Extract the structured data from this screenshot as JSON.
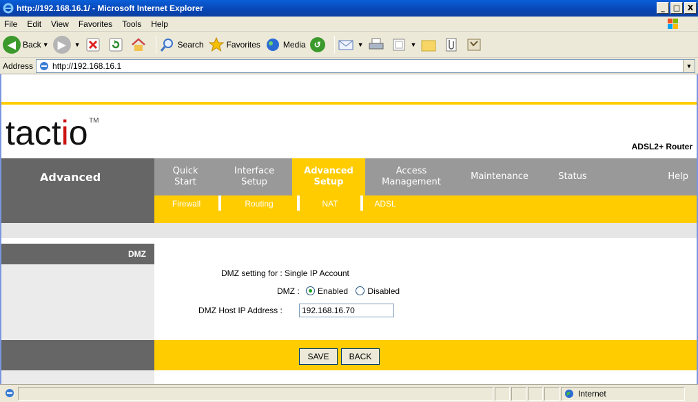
{
  "window": {
    "title": "http://192.168.16.1/ - Microsoft Internet Explorer",
    "controls": {
      "minimize": "_",
      "maximize": "□",
      "close": "X"
    }
  },
  "menubar": {
    "items": [
      "File",
      "Edit",
      "View",
      "Favorites",
      "Tools",
      "Help"
    ]
  },
  "toolbar": {
    "back_label": "Back",
    "search_label": "Search",
    "favorites_label": "Favorites",
    "media_label": "Media"
  },
  "address": {
    "label": "Address",
    "url": "http://192.168.16.1"
  },
  "page": {
    "logo": {
      "main_dark": "tact",
      "accent": "i",
      "end_dark": "o",
      "tm": "TM"
    },
    "product": "ADSL2+ Router",
    "section": "Advanced",
    "nav": [
      {
        "l1": "Quick",
        "l2": "Start"
      },
      {
        "l1": "Interface",
        "l2": "Setup"
      },
      {
        "l1": "Advanced",
        "l2": "Setup"
      },
      {
        "l1": "Access",
        "l2": "Management"
      },
      {
        "l1": "Maintenance",
        "l2": ""
      },
      {
        "l1": "Status",
        "l2": ""
      },
      {
        "l1": "Help",
        "l2": ""
      }
    ],
    "subnav": [
      "Firewall",
      "Routing",
      "NAT",
      "ADSL"
    ],
    "side_label": "DMZ",
    "form": {
      "setting_label": "DMZ setting for :",
      "setting_value": "Single IP Account",
      "dmz_label": "DMZ :",
      "enabled_label": "Enabled",
      "disabled_label": "Disabled",
      "host_label": "DMZ Host IP Address :",
      "host_value": "192.168.16.70",
      "dmz_state": "Enabled"
    },
    "buttons": {
      "save": "SAVE",
      "back": "BACK"
    }
  },
  "statusbar": {
    "zone": "Internet"
  },
  "colors": {
    "accent_yellow": "#ffcc00",
    "nav_grey": "#999999",
    "side_grey": "#666666",
    "logo_red": "#cc1111"
  }
}
